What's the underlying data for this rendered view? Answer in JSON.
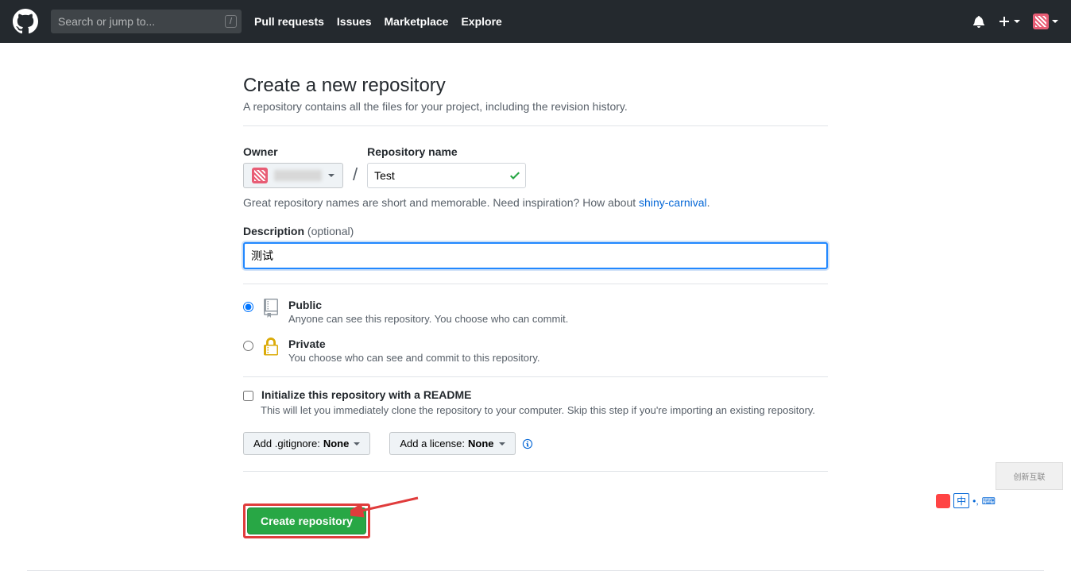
{
  "header": {
    "search_placeholder": "Search or jump to...",
    "slash_hint": "/",
    "nav": [
      "Pull requests",
      "Issues",
      "Marketplace",
      "Explore"
    ]
  },
  "page": {
    "title": "Create a new repository",
    "subtitle": "A repository contains all the files for your project, including the revision history.",
    "owner_label": "Owner",
    "repo_name_label": "Repository name",
    "repo_name_value": "Test",
    "inspiration_text": "Great repository names are short and memorable. Need inspiration? How about ",
    "inspiration_suggestion": "shiny-carnival",
    "inspiration_period": ".",
    "description_label": "Description ",
    "description_optional": "(optional)",
    "description_value": "测试",
    "public_title": "Public",
    "public_desc": "Anyone can see this repository. You choose who can commit.",
    "private_title": "Private",
    "private_desc": "You choose who can see and commit to this repository.",
    "readme_title": "Initialize this repository with a README",
    "readme_desc": "This will let you immediately clone the repository to your computer. Skip this step if you're importing an existing repository.",
    "gitignore_prefix": "Add .gitignore: ",
    "gitignore_value": "None",
    "license_prefix": "Add a license: ",
    "license_value": "None",
    "create_button": "Create repository"
  },
  "watermark": {
    "logo_text": "创新互联",
    "ime_char": "中"
  }
}
